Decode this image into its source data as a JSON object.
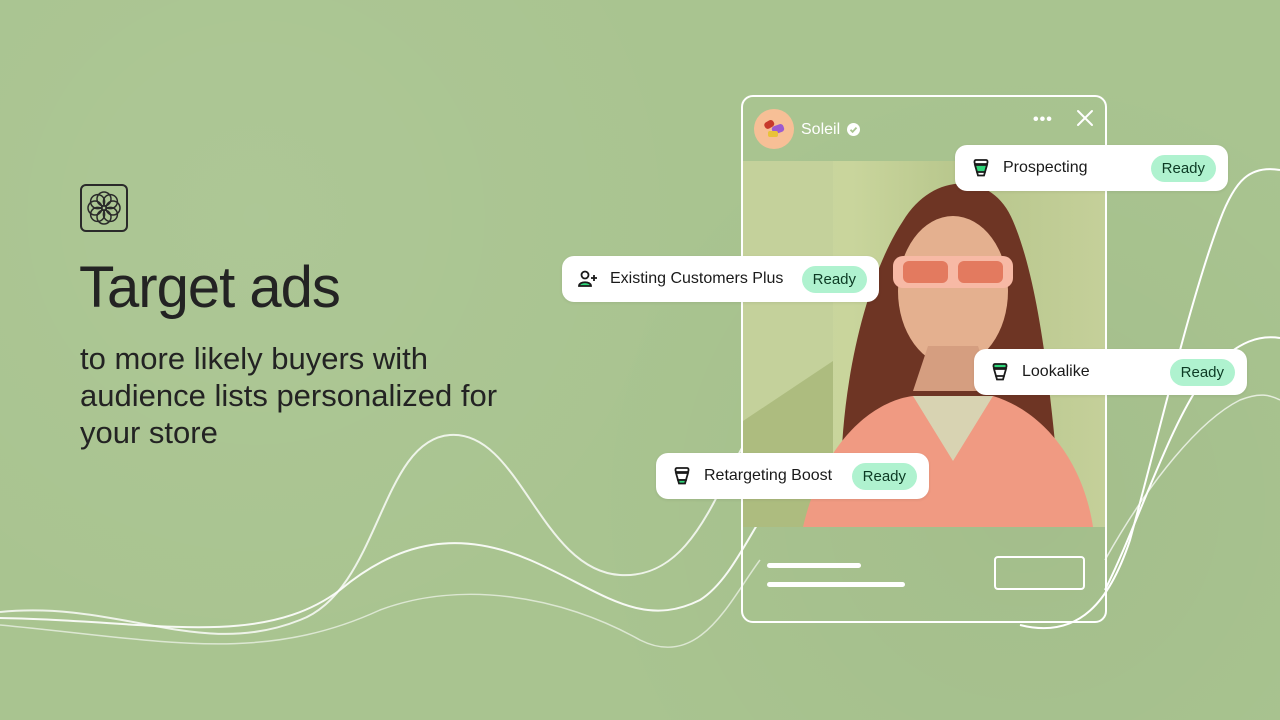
{
  "headline": "Target ads",
  "subheadline": "to more likely buyers with audience lists personalized for your store",
  "logo_icon": "flower-icon",
  "post": {
    "username": "Soleil",
    "verified_icon": "verified-check-icon",
    "more_icon": "more-horizontal-icon",
    "close_icon": "close-icon",
    "more_glyph": "•••"
  },
  "audiences": [
    {
      "label": "Prospecting",
      "status": "Ready",
      "icon": "funnel-icon"
    },
    {
      "label": "Existing Customers Plus",
      "status": "Ready",
      "icon": "person-add-icon"
    },
    {
      "label": "Lookalike",
      "status": "Ready",
      "icon": "funnel-icon"
    },
    {
      "label": "Retargeting Boost",
      "status": "Ready",
      "icon": "funnel-icon"
    }
  ],
  "colors": {
    "background": "#a9c490",
    "text": "#232323",
    "badge_bg": "#aff2cf",
    "badge_text": "#0c3a24",
    "accent_green": "#2fd67a"
  }
}
